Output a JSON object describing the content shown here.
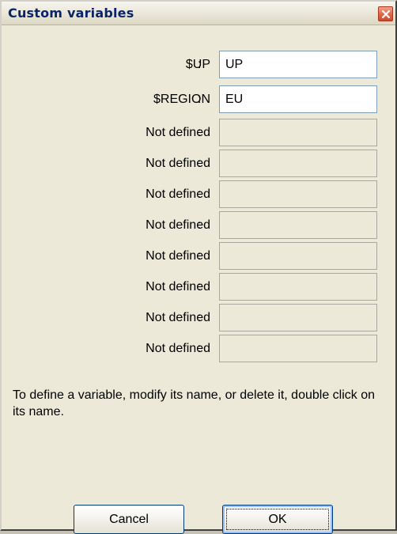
{
  "window": {
    "title": "Custom variables",
    "close_icon": "close-icon"
  },
  "variables": [
    {
      "name": "$UP",
      "value": "UP",
      "defined": true
    },
    {
      "name": "$REGION",
      "value": "EU",
      "defined": true
    },
    {
      "name": "Not defined",
      "value": "",
      "defined": false
    },
    {
      "name": "Not defined",
      "value": "",
      "defined": false
    },
    {
      "name": "Not defined",
      "value": "",
      "defined": false
    },
    {
      "name": "Not defined",
      "value": "",
      "defined": false
    },
    {
      "name": "Not defined",
      "value": "",
      "defined": false
    },
    {
      "name": "Not defined",
      "value": "",
      "defined": false
    },
    {
      "name": "Not defined",
      "value": "",
      "defined": false
    },
    {
      "name": "Not defined",
      "value": "",
      "defined": false
    }
  ],
  "separator": ":",
  "hint": "To define a variable, modify its name, or delete it, double click on its name.",
  "buttons": {
    "cancel_label": "Cancel",
    "ok_label": "OK"
  },
  "colors": {
    "title_text": "#0a246a",
    "close_button": "#e26a4c",
    "dialog_background": "#ece9d8",
    "field_border": "#7f9db9"
  }
}
